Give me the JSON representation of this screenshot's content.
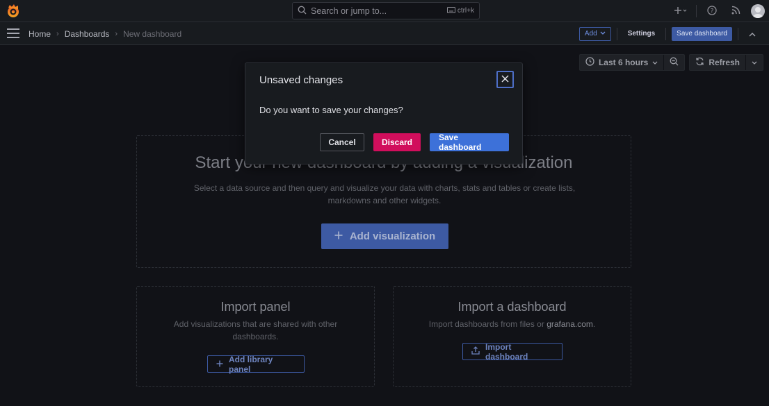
{
  "topbar": {
    "search_placeholder": "Search or jump to...",
    "shortcut": "ctrl+k"
  },
  "navbar": {
    "breadcrumbs": [
      "Home",
      "Dashboards",
      "New dashboard"
    ],
    "add_label": "Add",
    "settings_label": "Settings",
    "save_label": "Save dashboard"
  },
  "timepicker": {
    "range_label": "Last 6 hours",
    "refresh_label": "Refresh"
  },
  "empty_state": {
    "title": "Start your new dashboard by adding a visualization",
    "subtitle": "Select a data source and then query and visualize your data with charts, stats and tables or create lists, markdowns and other widgets.",
    "add_visualization_label": "Add visualization"
  },
  "import_panel": {
    "title": "Import panel",
    "text": "Add visualizations that are shared with other dashboards.",
    "button_label": "Add library panel"
  },
  "import_dashboard": {
    "title": "Import a dashboard",
    "text": "Import dashboards from files or",
    "link": "grafana.com",
    "period": ".",
    "button_label": "Import dashboard"
  },
  "modal": {
    "title": "Unsaved changes",
    "body": "Do you want to save your changes?",
    "cancel_label": "Cancel",
    "discard_label": "Discard",
    "save_label": "Save dashboard"
  },
  "colors": {
    "background": "#111217",
    "primary": "#3d71d9",
    "discard": "#d10e5c"
  }
}
